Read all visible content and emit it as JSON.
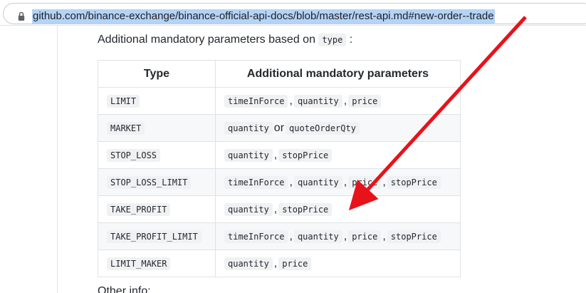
{
  "browser": {
    "url": "github.com/binance-exchange/binance-official-api-docs/blob/master/rest-api.md#new-order--trade",
    "lock_icon": "lock-icon"
  },
  "content": {
    "intro_prefix": "Additional mandatory parameters based on",
    "intro_code": "type",
    "intro_suffix": ":",
    "table": {
      "headers": [
        "Type",
        "Additional mandatory parameters"
      ],
      "rows": [
        {
          "type": "LIMIT",
          "params": [
            "timeInForce",
            "quantity",
            "price"
          ],
          "joiner": ","
        },
        {
          "type": "MARKET",
          "params": [
            "quantity",
            "quoteOrderQty"
          ],
          "joiner": "or"
        },
        {
          "type": "STOP_LOSS",
          "params": [
            "quantity",
            "stopPrice"
          ],
          "joiner": ","
        },
        {
          "type": "STOP_LOSS_LIMIT",
          "params": [
            "timeInForce",
            "quantity",
            "price",
            "stopPrice"
          ],
          "joiner": ","
        },
        {
          "type": "TAKE_PROFIT",
          "params": [
            "quantity",
            "stopPrice"
          ],
          "joiner": ","
        },
        {
          "type": "TAKE_PROFIT_LIMIT",
          "params": [
            "timeInForce",
            "quantity",
            "price",
            "stopPrice"
          ],
          "joiner": ","
        },
        {
          "type": "LIMIT_MAKER",
          "params": [
            "quantity",
            "price"
          ],
          "joiner": ","
        }
      ]
    },
    "bottom_text": "Other info:"
  },
  "annotation": {
    "arrow_color": "#e8121a"
  }
}
